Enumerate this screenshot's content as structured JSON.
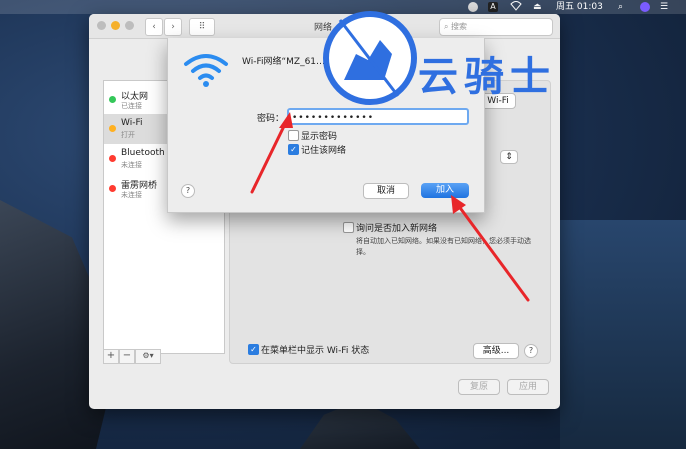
{
  "menubar": {
    "clock": "周五 01:03"
  },
  "window": {
    "title": "网络",
    "search_placeholder": "搜索",
    "nav_back": "‹",
    "nav_forward": "›",
    "grid": "⠿"
  },
  "sidebar": {
    "items": [
      {
        "name": "以太网",
        "status": "已连接",
        "color": "#34c759"
      },
      {
        "name": "Wi-Fi",
        "status": "打开",
        "color": "#ffb020"
      },
      {
        "name": "Bluetooth PAN",
        "status": "未连接",
        "color": "#ff3b30"
      },
      {
        "name": "雷雳网桥",
        "status": "未连接",
        "color": "#ff3b30"
      }
    ],
    "controls": {
      "add": "+",
      "remove": "−",
      "gear": "⚙▾"
    }
  },
  "panel": {
    "wifi_button": "Wi-Fi",
    "ask_join_label": "询问是否加入新网络",
    "ask_join_desc": "将自动加入已知网络。如果没有已知网络，您必须手动选择。",
    "show_status_label": "在菜单栏中显示 Wi-Fi 状态",
    "advanced_button": "高级...",
    "help": "?",
    "revert_button": "复原",
    "apply_button": "应用"
  },
  "dialog": {
    "title": "Wi-Fi网络“MZ_61…PA2”密码。",
    "password_label": "密码：",
    "password_value": "•••••••••••••",
    "show_password_label": "显示密码",
    "remember_label": "记住该网络",
    "cancel_button": "取消",
    "join_button": "加入",
    "help": "?"
  },
  "watermark": {
    "text": "云骑士"
  },
  "colors": {
    "accent": "#2b7de0",
    "annotation_arrow": "#e8262a"
  }
}
